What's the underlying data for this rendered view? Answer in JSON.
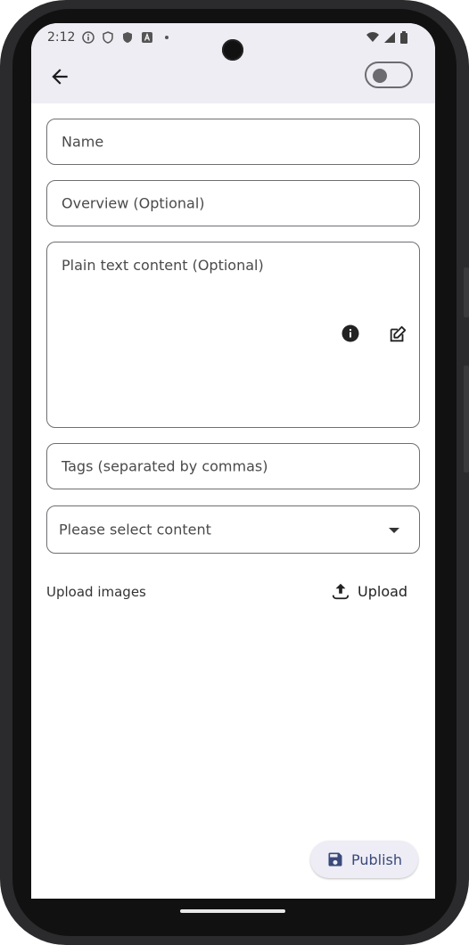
{
  "status_bar": {
    "time": "2:12",
    "icons": [
      "info-icon",
      "shield-icon",
      "shield-filled-icon",
      "a-icon",
      "dot-icon"
    ],
    "right_icons": [
      "wifi-icon",
      "signal-icon",
      "battery-icon"
    ]
  },
  "header": {
    "back_icon": "arrow-back-icon",
    "toggle_on": false
  },
  "form": {
    "name_placeholder": "Name",
    "overview_placeholder": "Overview (Optional)",
    "content_placeholder": "Plain text content (Optional)",
    "tags_placeholder": "Tags (separated by commas)",
    "select_placeholder": "Please select content",
    "upload_label": "Upload images",
    "upload_button": "Upload"
  },
  "actions": {
    "publish_label": "Publish"
  },
  "colors": {
    "topbar": "#eeedf3",
    "border": "#6f6f73",
    "publish_bg": "#eeedf6",
    "publish_text": "#3a4a7a"
  }
}
